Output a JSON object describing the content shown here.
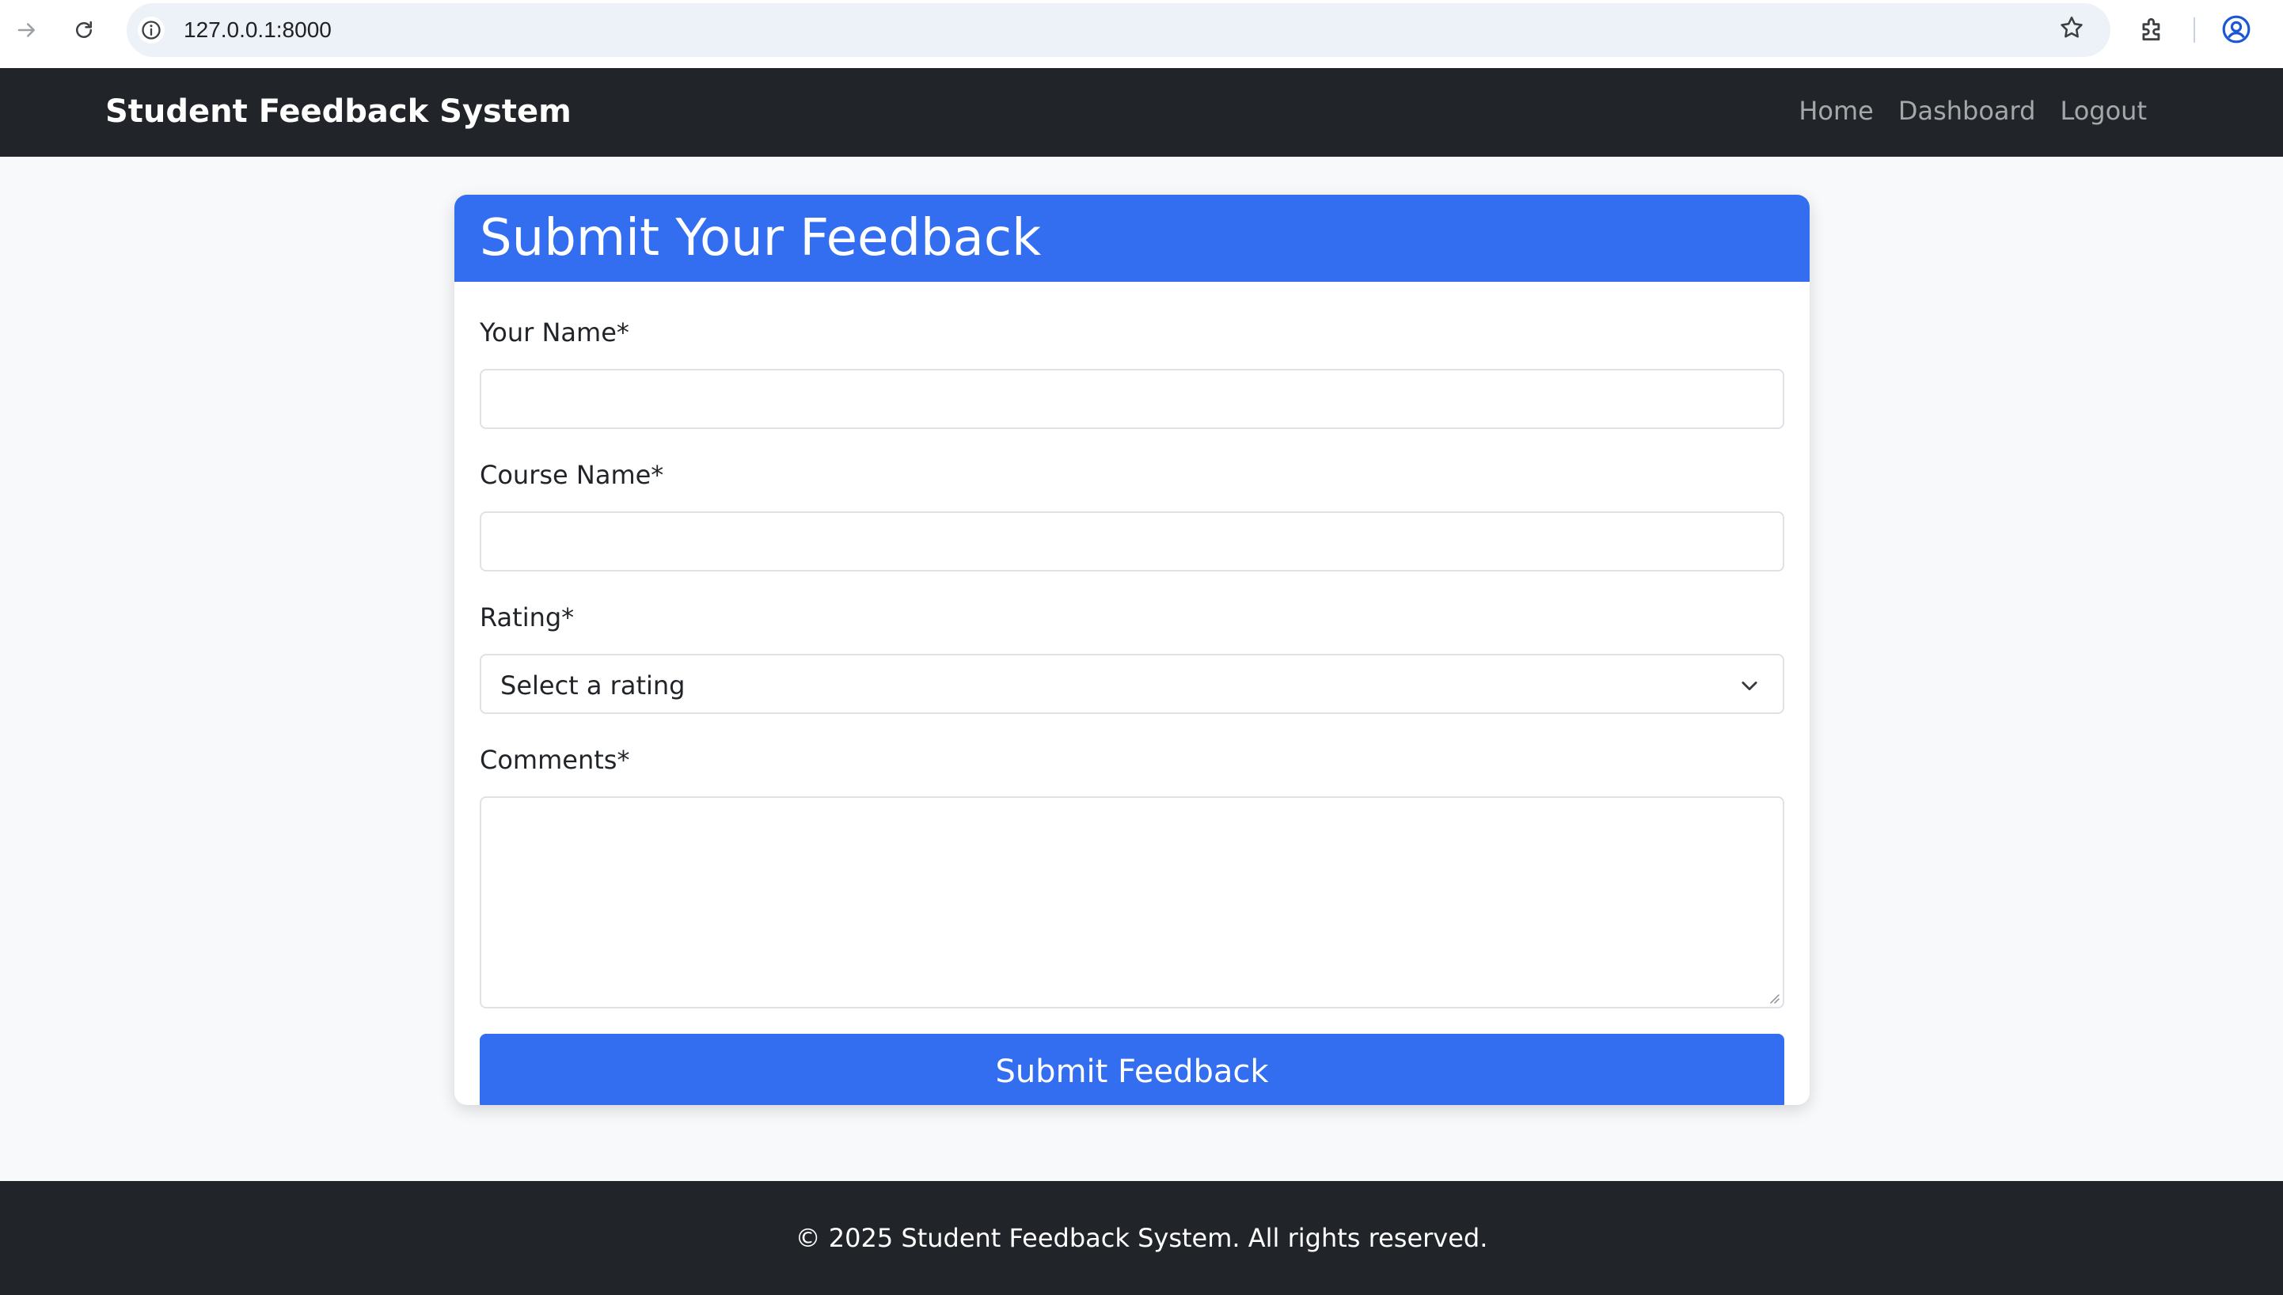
{
  "browser": {
    "url": "127.0.0.1:8000",
    "icons": [
      "forward-icon",
      "reload-icon",
      "info-icon",
      "star-icon",
      "extensions-icon",
      "profile-icon"
    ]
  },
  "navbar": {
    "brand": "Student Feedback System",
    "links": [
      "Home",
      "Dashboard",
      "Logout"
    ]
  },
  "form": {
    "title": "Submit Your Feedback",
    "name_label": "Your Name*",
    "name_value": "",
    "course_label": "Course Name*",
    "course_value": "",
    "rating_label": "Rating*",
    "rating_selected": "Select a rating",
    "comments_label": "Comments*",
    "comments_value": "",
    "submit_label": "Submit Feedback"
  },
  "footer": {
    "text": "© 2025 Student Feedback System. All rights reserved."
  },
  "colors": {
    "accent": "#336ef0",
    "dark": "#212529",
    "page_bg": "#f8f9fa"
  }
}
